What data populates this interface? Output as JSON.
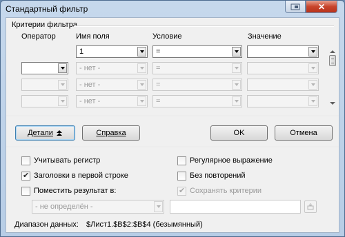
{
  "window": {
    "title": "Стандартный фильтр",
    "close_glyph": "✕"
  },
  "criteria": {
    "section_title": "Критерии фильтра",
    "columns": {
      "operator": "Оператор",
      "field_name": "Имя поля",
      "condition": "Условие",
      "value": "Значение"
    },
    "rows": [
      {
        "operator": "",
        "field": "1",
        "condition": "=",
        "value": ""
      },
      {
        "operator": "",
        "field": "- нет -",
        "condition": "=",
        "value": ""
      },
      {
        "operator": "",
        "field": "- нет -",
        "condition": "=",
        "value": ""
      },
      {
        "operator": "",
        "field": "- нет -",
        "condition": "=",
        "value": ""
      }
    ]
  },
  "buttons": {
    "details": "Детали",
    "help": "Справка",
    "ok": "OK",
    "cancel": "Отмена"
  },
  "options": {
    "case_sensitive": {
      "label": "Учитывать регистр",
      "checked": false
    },
    "headers_first_row": {
      "label": "Заголовки в первой строке",
      "checked": true
    },
    "copy_results": {
      "label": "Поместить результат в:",
      "checked": false
    },
    "regex": {
      "label": "Регулярное выражение",
      "checked": false
    },
    "no_duplicates": {
      "label": "Без повторений",
      "checked": false
    },
    "keep_criteria": {
      "label": "Сохранять критерии",
      "checked": true,
      "disabled": true
    },
    "result_target": {
      "value": "- не определён -",
      "text": ""
    }
  },
  "data_range": {
    "label": "Диапазон данных:",
    "value": "$Лист1.$B$2:$B$4 (безымянный)"
  },
  "icons": {
    "close": "close-icon",
    "details_toggle": "double-chevron-up-icon",
    "shrink": "shrink-icon"
  }
}
